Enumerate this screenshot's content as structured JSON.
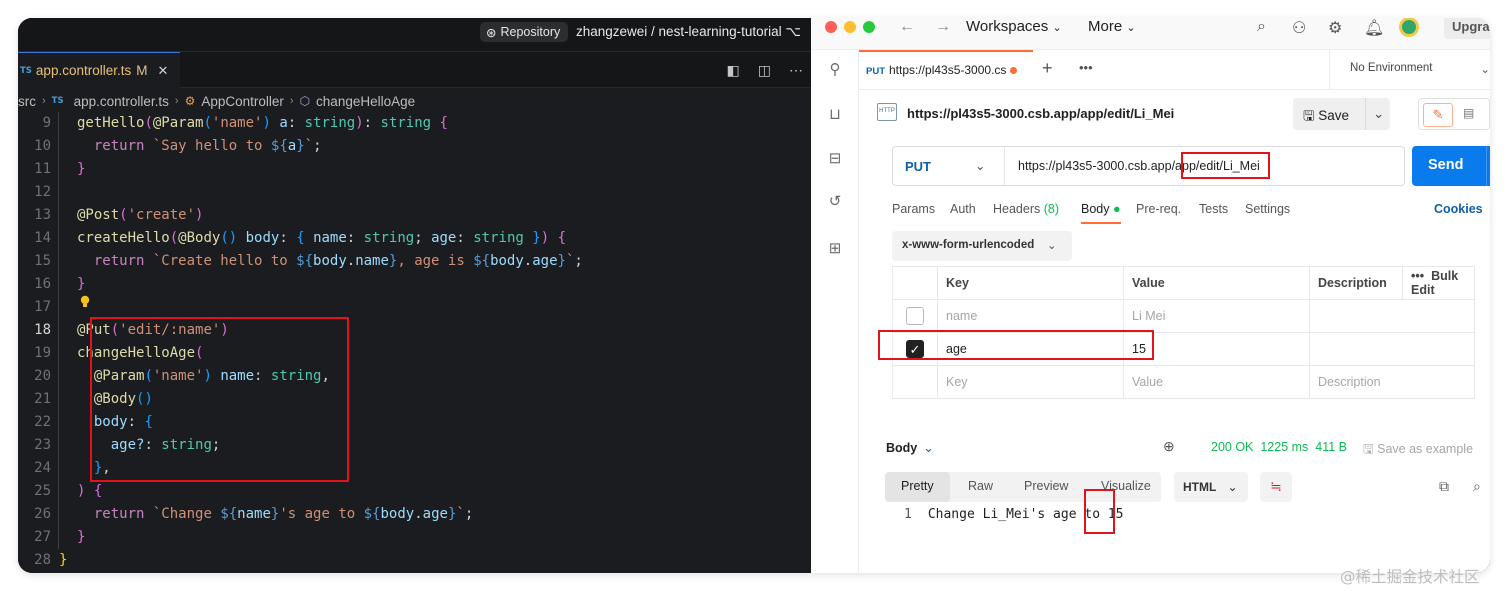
{
  "editor": {
    "repo_label": "Repository",
    "repo_path": "zhangzewei / nest-learning-tutorial",
    "repo_suffix": "⌥",
    "tab": {
      "lang_badge": "TS",
      "filename": "app.controller.ts",
      "status": "M",
      "close": "✕"
    },
    "breadcrumb": {
      "folder": "src",
      "lang_badge": "TS",
      "file": "app.controller.ts",
      "class": "AppController",
      "method": "changeHelloAge"
    },
    "line_numbers": [
      "9",
      "10",
      "11",
      "12",
      "13",
      "14",
      "15",
      "16",
      "17",
      "18",
      "19",
      "20",
      "21",
      "22",
      "23",
      "24",
      "25",
      "26",
      "27",
      "28"
    ]
  },
  "postman": {
    "nav": {
      "workspaces": "Workspaces",
      "more": "More",
      "upgrade": "Upgra"
    },
    "request_tab": {
      "method": "PUT",
      "url": "https://pl43s5-3000.cs"
    },
    "environment": "No Environment",
    "request_name": "https://pl43s5-3000.csb.app/app/edit/Li_Mei",
    "save_label": "Save",
    "method": "PUT",
    "url": "https://pl43s5-3000.csb.app/app/edit/Li_Mei",
    "send_label": "Send",
    "subtabs": {
      "params": "Params",
      "auth": "Auth",
      "headers": "Headers",
      "headers_count": "(8)",
      "body": "Body",
      "prereq": "Pre-req.",
      "tests": "Tests",
      "settings": "Settings",
      "cookies": "Cookies"
    },
    "body_type": "x-www-form-urlencoded",
    "table": {
      "headers": {
        "key": "Key",
        "value": "Value",
        "description": "Description",
        "bulk_edit": "Bulk Edit"
      },
      "rows": [
        {
          "key": "name",
          "value": "Li Mei",
          "checked": false
        },
        {
          "key": "age",
          "value": "15",
          "checked": true
        }
      ],
      "placeholder": {
        "key": "Key",
        "value": "Value",
        "description": "Description"
      }
    },
    "response": {
      "label": "Body",
      "status": "200 OK",
      "time": "1225 ms",
      "size": "411 B",
      "save_example": "Save as example",
      "tabs": {
        "pretty": "Pretty",
        "raw": "Raw",
        "preview": "Preview",
        "visualize": "Visualize"
      },
      "format": "HTML",
      "line_number": "1",
      "text_prefix": "Change Li_Mei's age to ",
      "text_value": "15"
    }
  },
  "watermark": "@稀土掘金技术社区"
}
